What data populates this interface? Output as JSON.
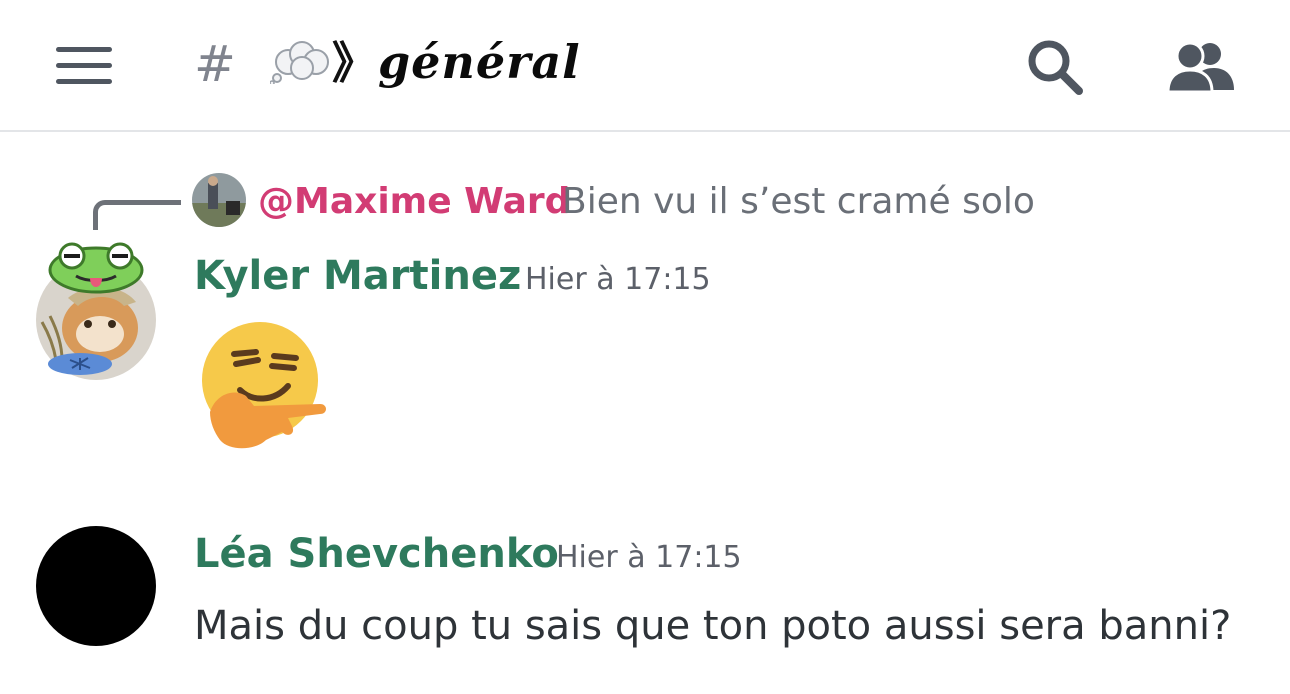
{
  "header": {
    "hash_symbol": "#",
    "separator": "》",
    "channel_name": "général",
    "icons": [
      "menu-icon",
      "thought-balloon-icon",
      "search-icon",
      "members-icon"
    ]
  },
  "reply": {
    "author": "@Maxime Ward",
    "text": "Bien vu il s’est cramé solo"
  },
  "messages": [
    {
      "author": "Kyler Martinez",
      "timestamp": "Hier à 17:15",
      "author_color": "#2e7a5d",
      "content_emoji": "smirk-pointing-emoji"
    },
    {
      "author": "Léa Shevchenko",
      "timestamp": "Hier à 17:15",
      "author_color": "#2e7a5d",
      "text": "Mais du coup tu sais que ton poto aussi sera banni?"
    }
  ],
  "colors": {
    "reply_author": "#d23c74",
    "icon_gray": "#4f5660"
  }
}
